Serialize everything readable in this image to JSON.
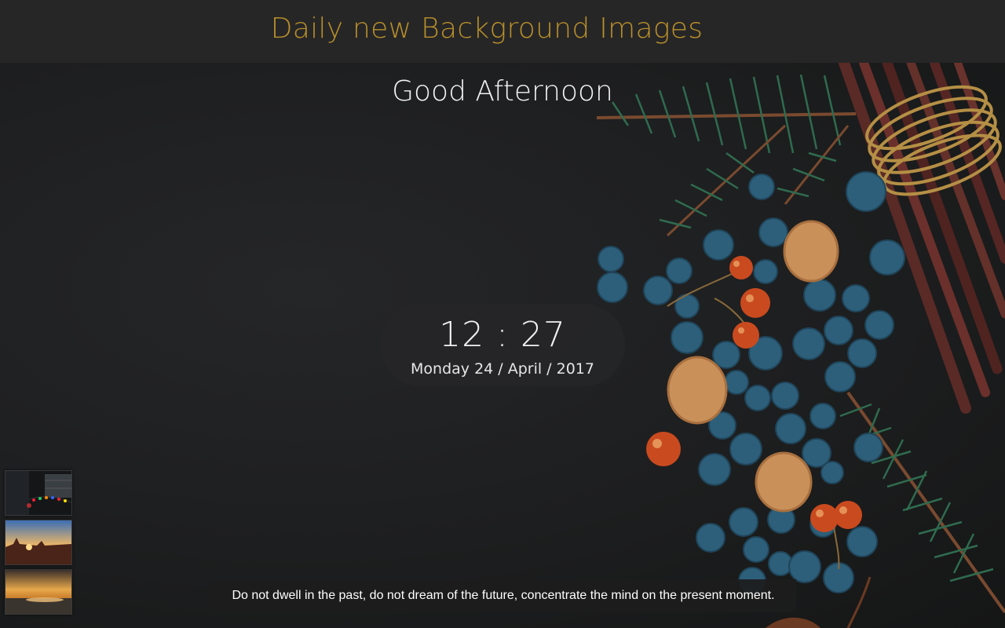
{
  "header": {
    "title": "Daily new Background Images",
    "title_color": "#b8902a"
  },
  "greeting": "Good Afternoon",
  "clock": {
    "time": "12 : 27",
    "date": "Monday 24 / April / 2017"
  },
  "quote": "Do not dwell in the past, do not dream of the future, concentrate the mind on the present moment.",
  "thumbnails": [
    {
      "name": "thumbnail-night-lights"
    },
    {
      "name": "thumbnail-desert-sunset"
    },
    {
      "name": "thumbnail-beach-sunset"
    }
  ]
}
